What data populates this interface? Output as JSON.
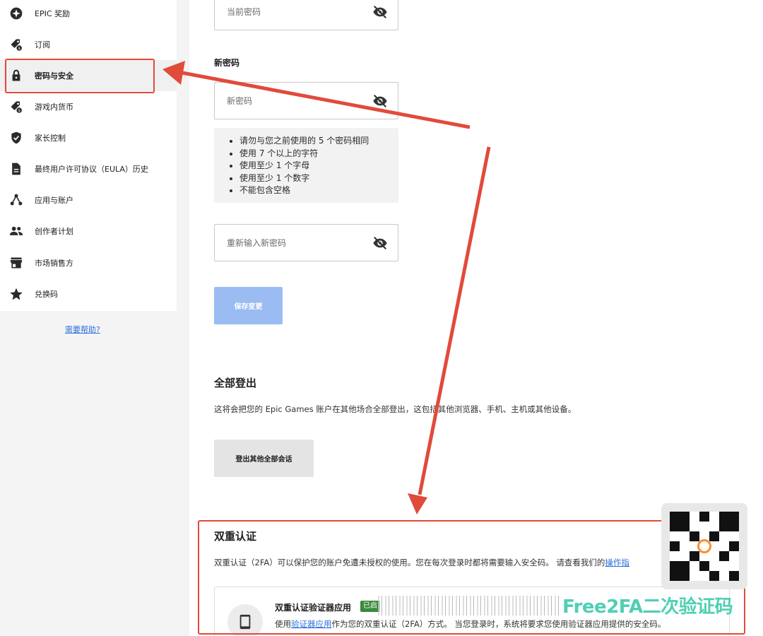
{
  "sidebar": {
    "items": [
      {
        "label": "EPIC 奖励",
        "icon": "epic-rewards-icon"
      },
      {
        "label": "订阅",
        "icon": "subscription-tag-icon"
      },
      {
        "label": "密码与安全",
        "icon": "lock-icon",
        "active": true
      },
      {
        "label": "游戏内货币",
        "icon": "currency-tag-icon"
      },
      {
        "label": "家长控制",
        "icon": "shield-check-icon"
      },
      {
        "label": "最终用户许可协议（EULA）历史",
        "icon": "document-icon"
      },
      {
        "label": "应用与账户",
        "icon": "connections-icon"
      },
      {
        "label": "创作者计划",
        "icon": "people-icon"
      },
      {
        "label": "市场销售方",
        "icon": "storefront-icon"
      },
      {
        "label": "兑换码",
        "icon": "star-icon"
      }
    ],
    "help_link": "需要帮助?"
  },
  "password": {
    "current_placeholder": "当前密码",
    "new_label": "新密码",
    "new_placeholder": "新密码",
    "rules": [
      "请勿与您之前使用的 5 个密码相同",
      "使用 7 个以上的字符",
      "使用至少 1 个字母",
      "使用至少 1 个数字",
      "不能包含空格"
    ],
    "confirm_placeholder": "重新输入新密码",
    "save_label": "保存变更"
  },
  "logout": {
    "title": "全部登出",
    "description": "这将会把您的 Epic Games 账户在其他场合全部登出，这包括其他浏览器、手机、主机或其他设备。",
    "button_label": "登出其他全部会话"
  },
  "two_factor": {
    "title": "双重认证",
    "description_prefix": "双重认证（2FA）可以保护您的账户免遭未授权的使用。您在每次登录时都将需要输入安全码。 请查看我们的",
    "description_link": "操作指",
    "card": {
      "title": "双重认证验证器应用",
      "badge": "已启",
      "desc_prefix": "使用",
      "desc_link": "验证器应用",
      "desc_suffix": "作为您的双重认证（2FA）方式。 当您登录时，系统将要求您使用验证器应用提供的安全码。"
    }
  },
  "watermark": {
    "text": "Free2FA二次验证码"
  },
  "colors": {
    "accent": "#2a6fdb",
    "annotation": "#e04b3a",
    "save_disabled": "#9bbcf2",
    "badge": "#3a8a3a"
  }
}
